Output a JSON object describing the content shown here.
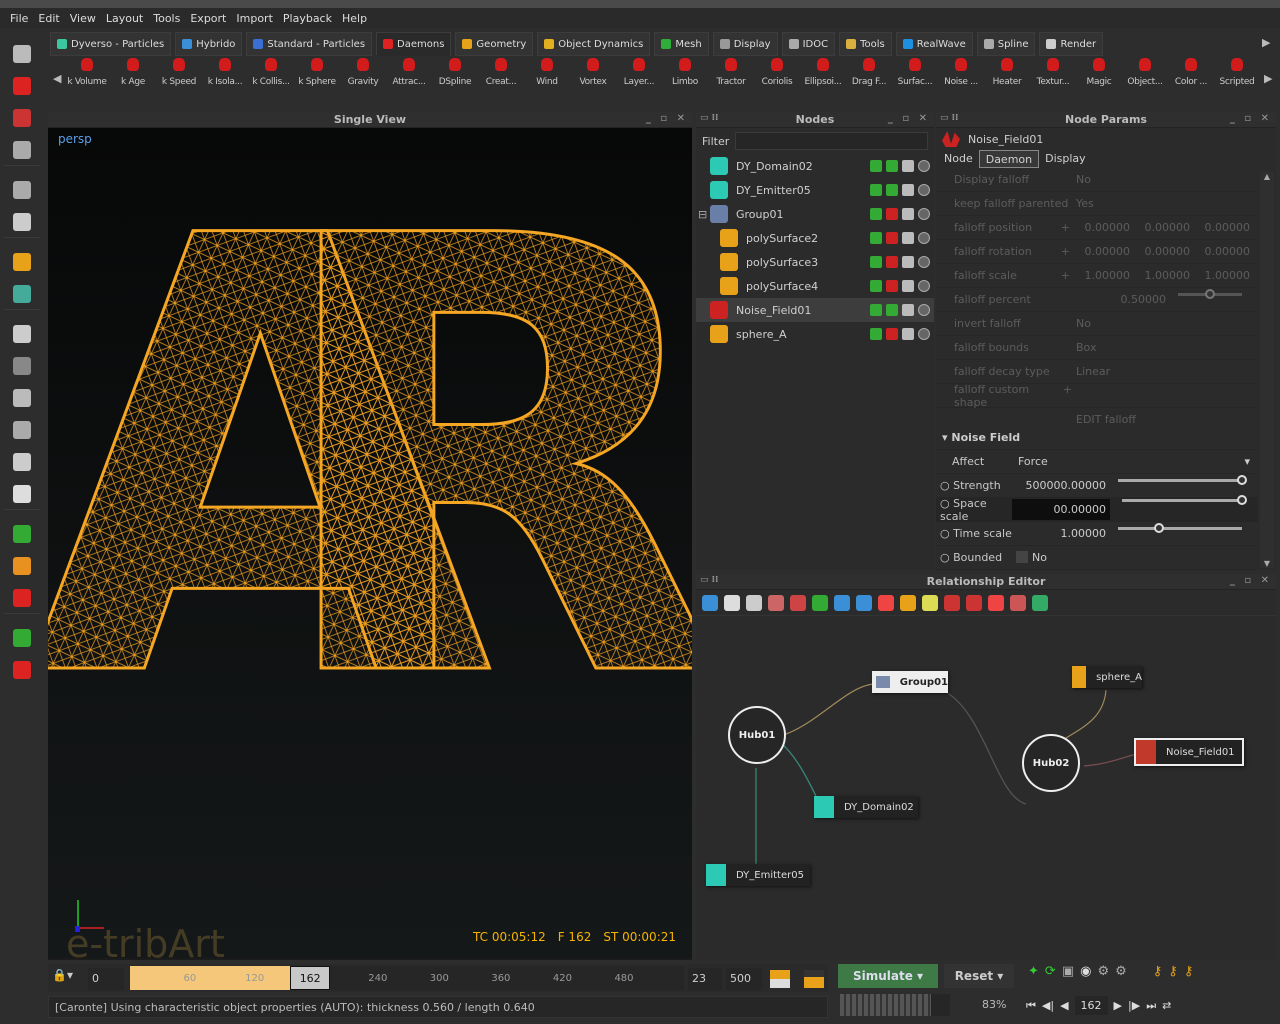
{
  "menu": [
    "File",
    "Edit",
    "View",
    "Layout",
    "Tools",
    "Export",
    "Import",
    "Playback",
    "Help"
  ],
  "tabs": [
    {
      "label": "Dyverso - Particles",
      "color": "#3bc6a0"
    },
    {
      "label": "Hybrido",
      "color": "#3a8fd6"
    },
    {
      "label": "Standard - Particles",
      "color": "#3a6fd6"
    },
    {
      "label": "Daemons",
      "color": "#d22",
      "active": true
    },
    {
      "label": "Geometry",
      "color": "#e8a21a"
    },
    {
      "label": "Object Dynamics",
      "color": "#e0b020"
    },
    {
      "label": "Mesh",
      "color": "#2fae3b"
    },
    {
      "label": "Display",
      "color": "#999"
    },
    {
      "label": "IDOC",
      "color": "#aaa"
    },
    {
      "label": "Tools",
      "color": "#d8b040"
    },
    {
      "label": "RealWave",
      "color": "#1e90e0"
    },
    {
      "label": "Spline",
      "color": "#aaa"
    },
    {
      "label": "Render",
      "color": "#ccc"
    }
  ],
  "daemons": [
    "k Volume",
    "k Age",
    "k Speed",
    "k Isola...",
    "k Collis...",
    "k Sphere",
    "Gravity",
    "Attrac...",
    "DSpline",
    "Creat...",
    "Wind",
    "Vortex",
    "Layer...",
    "Limbo",
    "Tractor",
    "Coriolis",
    "Ellipsoi...",
    "Drag F...",
    "Surfac...",
    "Noise ...",
    "Heater",
    "Textur...",
    "Magic",
    "Object...",
    "Color ...",
    "Scripted"
  ],
  "left_tools": [
    {
      "icon": "select-arrow-icon",
      "color": "#bbb"
    },
    {
      "icon": "emitter-icon",
      "color": "#d22"
    },
    {
      "icon": "rotate-icon",
      "color": "#c33"
    },
    {
      "icon": "scale-icon",
      "color": "#aaa"
    },
    {
      "icon": "layout-icon",
      "color": "#aaa"
    },
    {
      "icon": "cube-tools-icon",
      "color": "#ccc"
    },
    {
      "icon": "pencil-icon",
      "color": "#e8a21a"
    },
    {
      "icon": "axis-icon",
      "color": "#4a9"
    },
    {
      "icon": "point-cube-icon",
      "color": "#ccc"
    },
    {
      "icon": "wire-sphere-icon",
      "color": "#888"
    },
    {
      "icon": "box-icon",
      "color": "#bbb"
    },
    {
      "icon": "grid-sphere-icon",
      "color": "#aaa"
    },
    {
      "icon": "shaded-sphere-icon",
      "color": "#ccc"
    },
    {
      "icon": "smooth-sphere-icon",
      "color": "#ddd"
    },
    {
      "icon": "green-brush-icon",
      "color": "#3a3"
    },
    {
      "icon": "rocket-icon",
      "color": "#e89020"
    },
    {
      "icon": "red-brush-icon",
      "color": "#d22"
    },
    {
      "icon": "save-green-icon",
      "color": "#3a3"
    },
    {
      "icon": "save-red-icon",
      "color": "#d22"
    }
  ],
  "viewport": {
    "title": "Single View",
    "camera": "persp",
    "timecode": "TC 00:05:12",
    "frame": "F 162",
    "simtime": "ST 00:00:21",
    "letters": "AR",
    "watermark": "e-tribArt"
  },
  "nodes": {
    "title": "Nodes",
    "filter_label": "Filter",
    "filter_value": "",
    "items": [
      {
        "name": "DY_Domain02",
        "color": "#2cc9b5",
        "indent": 0,
        "saved": "green"
      },
      {
        "name": "DY_Emitter05",
        "color": "#2cc9b5",
        "indent": 0,
        "saved": "green"
      },
      {
        "name": "Group01",
        "color": "#6a7fa8",
        "indent": 0,
        "saved": "red",
        "expander": "⊟"
      },
      {
        "name": "polySurface2",
        "color": "#e8a21a",
        "indent": 1,
        "saved": "red"
      },
      {
        "name": "polySurface3",
        "color": "#e8a21a",
        "indent": 1,
        "saved": "red"
      },
      {
        "name": "polySurface4",
        "color": "#e8a21a",
        "indent": 1,
        "saved": "red"
      },
      {
        "name": "Noise_Field01",
        "color": "#c22",
        "indent": 0,
        "saved": "green",
        "selected": true
      },
      {
        "name": "sphere_A",
        "color": "#e8a21a",
        "indent": 0,
        "saved": "red"
      }
    ]
  },
  "params": {
    "title": "Node Params",
    "node_name": "Noise_Field01",
    "tabs": [
      "Node",
      "Daemon",
      "Display"
    ],
    "active_tab": "Daemon",
    "falloff_rows": [
      {
        "label": "Display falloff",
        "values": [
          "No"
        ]
      },
      {
        "label": "keep falloff parented",
        "values": [
          "Yes"
        ]
      },
      {
        "label": "falloff position",
        "plus": "+",
        "values": [
          "0.00000",
          "0.00000",
          "0.00000"
        ]
      },
      {
        "label": "falloff rotation",
        "plus": "+",
        "values": [
          "0.00000",
          "0.00000",
          "0.00000"
        ]
      },
      {
        "label": "falloff scale",
        "plus": "+",
        "values": [
          "1.00000",
          "1.00000",
          "1.00000"
        ]
      },
      {
        "label": "falloff percent",
        "values": [
          "0.50000"
        ]
      },
      {
        "label": "invert falloff",
        "values": [
          "No"
        ]
      },
      {
        "label": "falloff bounds",
        "values": [
          "Box"
        ]
      },
      {
        "label": "falloff decay type",
        "values": [
          "Linear"
        ]
      },
      {
        "label": "falloff custom shape",
        "plus": "+",
        "values": [
          ""
        ]
      },
      {
        "label": "",
        "values": [
          "EDIT falloff"
        ]
      }
    ],
    "section": "Noise Field",
    "affect_label": "Affect",
    "affect_value": "Force",
    "strength_label": "Strength",
    "strength_value": "500000.00000",
    "strength_slider": 1.0,
    "space_label": "Space scale",
    "space_value": "00.00000",
    "space_slider": 1.0,
    "time_label": "Time scale",
    "time_value": "1.00000",
    "time_slider": 0.33,
    "bounded_label": "Bounded",
    "bounded_value": "No",
    "falloff_percent_slider": 0.5
  },
  "rel": {
    "title": "Relationship Editor",
    "tools": [
      "#3a8fd6",
      "#ddd",
      "#ccc",
      "#c66",
      "#c44",
      "#3a3",
      "#3a8fd6",
      "#3a8fd6",
      "#e44",
      "#e8a21a",
      "#dd5",
      "#c33",
      "#c33",
      "#e44",
      "#c55",
      "#3a6"
    ],
    "hubs": [
      "Hub01",
      "Hub02"
    ],
    "nodes": {
      "group": "Group01",
      "sphere": "sphere_A",
      "noise": "Noise_Field01",
      "domain": "DY_Domain02",
      "emitter": "DY_Emitter05"
    }
  },
  "timeline": {
    "start": "0",
    "ticks": [
      "60",
      "120",
      "240",
      "300",
      "360",
      "420",
      "480"
    ],
    "current": "162",
    "fps": "23",
    "end": "500",
    "progress": 0.324
  },
  "sim": {
    "simulate": "Simulate",
    "reset": "Reset",
    "percent": "83%",
    "frame": "162",
    "progress": 0.83
  },
  "status": "[Caronte] Using characteristic object properties (AUTO): thickness 0.560 / length 0.640"
}
